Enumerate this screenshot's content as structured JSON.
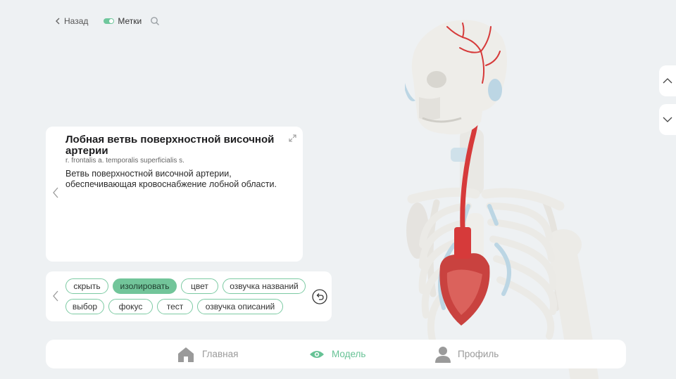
{
  "topbar": {
    "back_label": "Назад",
    "labels_toggle": "Метки",
    "labels_on": true
  },
  "info": {
    "title": "Лобная ветвь поверхностной височной артерии",
    "latin": "r. frontalis a. temporalis superficialis s.",
    "description": "Ветвь поверхностной височной артерии, обеспечивающая кровоснабжение лобной области."
  },
  "actions": {
    "chips": [
      {
        "label": "скрыть",
        "active": false
      },
      {
        "label": "изолировать",
        "active": true
      },
      {
        "label": "цвет",
        "active": false
      },
      {
        "label": "озвучка названий",
        "active": false
      },
      {
        "label": "выбор",
        "active": false
      },
      {
        "label": "фокус",
        "active": false
      },
      {
        "label": "тест",
        "active": false
      },
      {
        "label": "озвучка описаний",
        "active": false
      }
    ]
  },
  "bottom_nav": {
    "home": "Главная",
    "model": "Модель",
    "profile": "Профиль",
    "active": "model"
  },
  "colors": {
    "accent": "#6fc79c",
    "artery": "#d63a3a",
    "bone": "#ecebe7",
    "cartilage": "#bcd6e4"
  },
  "icons": [
    "chevron-left-icon",
    "search-icon",
    "expand-icon",
    "undo-icon",
    "chevron-up-icon",
    "chevron-down-icon",
    "home-icon",
    "eye-icon",
    "profile-icon"
  ]
}
